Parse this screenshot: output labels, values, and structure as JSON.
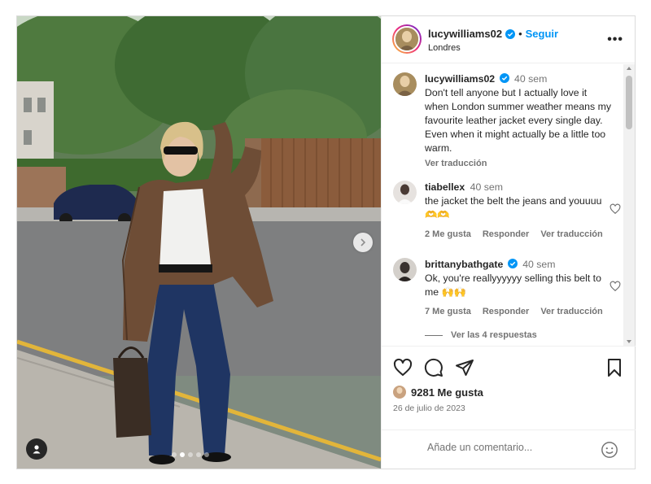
{
  "post": {
    "username": "lucywilliams02",
    "follow_label": "Seguir",
    "separator": "•",
    "location": "Londres",
    "more_label": "•••"
  },
  "comments": [
    {
      "username": "lucywilliams02",
      "time": "40 sem",
      "text": "Don't tell anyone but I actually love it when London summer weather means my favourite leather jacket every single day. Even when it might actually be a little too warm.",
      "translate_label": "Ver traducción"
    },
    {
      "username": "tiabellex",
      "time": "40 sem",
      "text": "the jacket the belt the jeans and youuuu 🫶🫶",
      "likes": "2 Me gusta",
      "reply_label": "Responder",
      "translate_label": "Ver traducción"
    },
    {
      "username": "brittanybathgate",
      "time": "40 sem",
      "text": "Ok, you're reallyyyyyy selling this belt to me 🙌🙌",
      "likes": "7 Me gusta",
      "reply_label": "Responder",
      "translate_label": "Ver traducción"
    }
  ],
  "view_replies_label": "Ver las 4 respuestas",
  "likes_count": "9281 Me gusta",
  "date": "26 de julio de 2023",
  "add_comment": {
    "placeholder": "Añade un comentario..."
  },
  "icons": {
    "like": "heart-icon",
    "comment": "comment-icon",
    "share": "share-icon",
    "save": "bookmark-icon",
    "emoji": "emoji-icon",
    "next": "chevron-right-icon",
    "tags": "user-tag-icon",
    "verified": "verified-badge-icon"
  },
  "colors": {
    "follow": "#0095f6",
    "verified": "#0095f6",
    "muted": "#737373"
  },
  "carousel": {
    "slides": 5,
    "active_index": 1
  }
}
